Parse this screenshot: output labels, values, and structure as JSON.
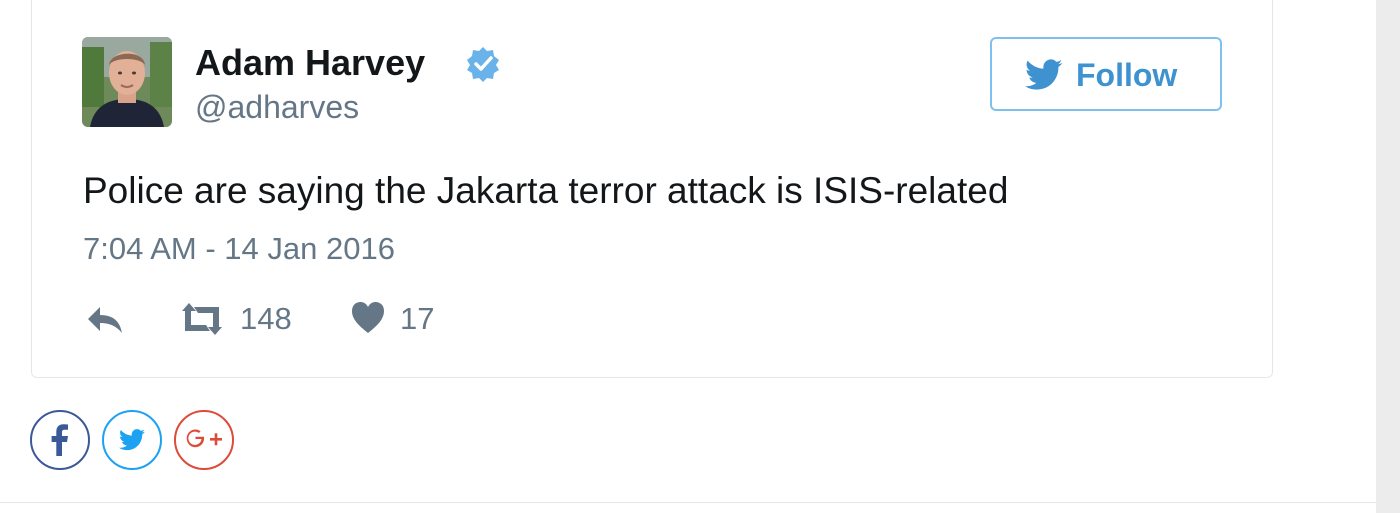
{
  "tweet": {
    "author_name": "Adam Harvey",
    "handle": "@adharves",
    "verified": true,
    "follow_label": "Follow",
    "text": "Police are saying the Jakarta terror attack is ISIS-related",
    "timestamp": "7:04 AM - 14 Jan 2016",
    "actions": {
      "reply_icon": "reply-icon",
      "retweet_count": "148",
      "like_count": "17"
    }
  },
  "share": {
    "buttons": [
      {
        "name": "facebook",
        "icon": "facebook-icon",
        "color": "#3b5998"
      },
      {
        "name": "twitter",
        "icon": "twitter-icon",
        "color": "#1da1f2"
      },
      {
        "name": "google-plus",
        "icon": "google-plus-icon",
        "color": "#dd4b39"
      }
    ]
  },
  "colors": {
    "accent": "#1da1f2",
    "follow_text": "#3f92d0",
    "verified_badge": "#6ab3ea",
    "muted_text": "#657786",
    "icon_gray": "#657786"
  }
}
